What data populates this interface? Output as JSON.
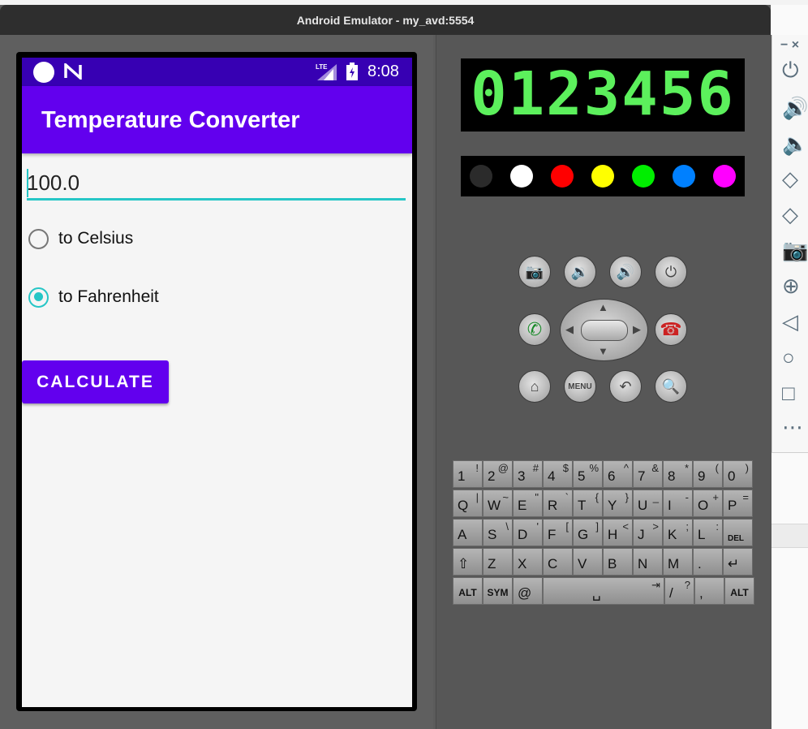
{
  "window": {
    "title": "Android Emulator - my_avd:5554"
  },
  "statusbar": {
    "network": "LTE",
    "time": "8:08"
  },
  "app": {
    "title": "Temperature Converter",
    "temperature_value": "100.0",
    "radio_options": [
      {
        "label": "to Celsius",
        "selected": false
      },
      {
        "label": "to Fahrenheit",
        "selected": true
      }
    ],
    "calculate_label": "CALCULATE",
    "accent_color": "#26c6c6",
    "primary_color": "#6200ee",
    "primary_dark_color": "#3700b3"
  },
  "emulator": {
    "display_digits": "0123456",
    "color_swatches": [
      "#2b2b2b",
      "#ffffff",
      "#ff0000",
      "#ffff00",
      "#00ee00",
      "#0080ff",
      "#ff00ff"
    ],
    "buttons": {
      "camera": "camera-icon",
      "volume_down": "volume-down-icon",
      "volume_up": "volume-up-icon",
      "power": "power-icon",
      "call": "call-icon",
      "end_call": "end-call-icon",
      "home": "home-icon",
      "menu_label": "MENU",
      "back": "back-icon",
      "search": "search-icon"
    },
    "keyboard": {
      "row1": [
        {
          "m": "1",
          "a": "!"
        },
        {
          "m": "2",
          "a": "@"
        },
        {
          "m": "3",
          "a": "#"
        },
        {
          "m": "4",
          "a": "$"
        },
        {
          "m": "5",
          "a": "%"
        },
        {
          "m": "6",
          "a": "^"
        },
        {
          "m": "7",
          "a": "&"
        },
        {
          "m": "8",
          "a": "*"
        },
        {
          "m": "9",
          "a": "("
        },
        {
          "m": "0",
          "a": ")"
        }
      ],
      "row2": [
        {
          "m": "Q",
          "a": "|"
        },
        {
          "m": "W",
          "a": "~"
        },
        {
          "m": "E",
          "a": "\""
        },
        {
          "m": "R",
          "a": "`"
        },
        {
          "m": "T",
          "a": "{"
        },
        {
          "m": "Y",
          "a": "}"
        },
        {
          "m": "U",
          "a": "_"
        },
        {
          "m": "I",
          "a": "-"
        },
        {
          "m": "O",
          "a": "+"
        },
        {
          "m": "P",
          "a": "="
        }
      ],
      "row3": [
        {
          "m": "A",
          "a": ""
        },
        {
          "m": "S",
          "a": "\\"
        },
        {
          "m": "D",
          "a": "'"
        },
        {
          "m": "F",
          "a": "["
        },
        {
          "m": "G",
          "a": "]"
        },
        {
          "m": "H",
          "a": "<"
        },
        {
          "m": "J",
          "a": ">"
        },
        {
          "m": "K",
          "a": ";"
        },
        {
          "m": "L",
          "a": ":"
        },
        {
          "m": "DEL",
          "a": ""
        }
      ],
      "row4": [
        {
          "m": "⇧",
          "a": ""
        },
        {
          "m": "Z",
          "a": ""
        },
        {
          "m": "X",
          "a": ""
        },
        {
          "m": "C",
          "a": ""
        },
        {
          "m": "V",
          "a": ""
        },
        {
          "m": "B",
          "a": ""
        },
        {
          "m": "N",
          "a": ""
        },
        {
          "m": "M",
          "a": ""
        },
        {
          "m": ".",
          "a": ""
        },
        {
          "m": "↵",
          "a": ""
        }
      ],
      "row5": [
        {
          "m": "ALT",
          "a": ""
        },
        {
          "m": "SYM",
          "a": ""
        },
        {
          "m": "@",
          "a": ""
        },
        {
          "m": "␣",
          "a": "⇥"
        },
        {
          "m": "/",
          "a": "?"
        },
        {
          "m": ",",
          "a": ""
        },
        {
          "m": "ALT",
          "a": ""
        }
      ]
    }
  },
  "toolbar": {
    "close": "×",
    "minimize": "−",
    "icons": [
      "power-icon",
      "volume-up-icon",
      "volume-down-icon",
      "rotate-left-icon",
      "rotate-right-icon",
      "screenshot-icon",
      "zoom-icon",
      "back-icon",
      "home-icon",
      "overview-icon",
      "more-icon"
    ]
  }
}
